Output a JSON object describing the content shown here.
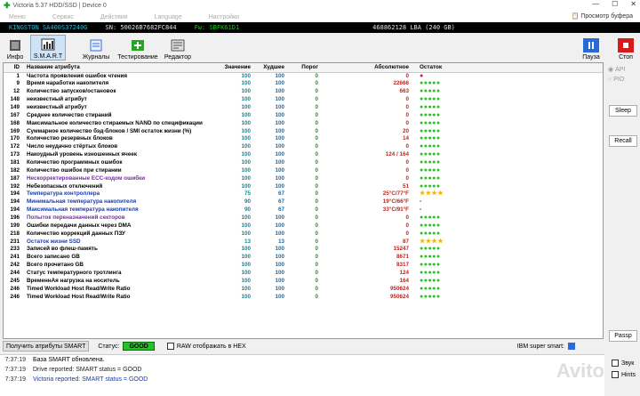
{
  "window": {
    "title": "Victoria 5.37 HDD/SSD | Device 0"
  },
  "menu": {
    "items": [
      "Меню",
      "Сервис",
      "Действия",
      "Language",
      "Настройки"
    ],
    "clipboard_label": "Просмотр буфера"
  },
  "infobar": {
    "model": "KINGSTON SA400S37240G",
    "serial": "SN: 50026B7682FC844",
    "firmware": "Fw: SBFK61D1",
    "lba": "468862128 LBA (240 GB)"
  },
  "toolbar": {
    "info": "Инфо",
    "smart": "S.M.A.R.T",
    "journals": "Журналы",
    "testing": "Тестирование",
    "editor": "Редактор",
    "pause": "Пауза",
    "stop": "Стоп"
  },
  "table": {
    "headers": {
      "id": "ID",
      "name": "Название атрибута",
      "value": "Значение",
      "worst": "Худшее",
      "threshold": "Порог",
      "raw": "Абсолютное",
      "rest": "Остаток"
    },
    "rows": [
      {
        "id": "1",
        "name": "Частота проявления ошибок чтения",
        "value": "100",
        "worst": "100",
        "thr": "0",
        "raw": "0",
        "rest": "●"
      },
      {
        "id": "9",
        "name": "Время наработки накопителя",
        "value": "100",
        "worst": "100",
        "thr": "0",
        "raw": "22666",
        "rest": "●●●●●"
      },
      {
        "id": "12",
        "name": "Количество запусков/остановок",
        "value": "100",
        "worst": "100",
        "thr": "0",
        "raw": "663",
        "rest": "●●●●●"
      },
      {
        "id": "148",
        "name": "неизвестный атрибут",
        "value": "100",
        "worst": "100",
        "thr": "0",
        "raw": "0",
        "rest": "●●●●●"
      },
      {
        "id": "149",
        "name": "неизвестный атрибут",
        "value": "100",
        "worst": "100",
        "thr": "0",
        "raw": "0",
        "rest": "●●●●●"
      },
      {
        "id": "167",
        "name": "Среднее количество стираний",
        "value": "100",
        "worst": "100",
        "thr": "0",
        "raw": "0",
        "rest": "●●●●●"
      },
      {
        "id": "168",
        "name": "Максимальное количество стираемых NAND по спецификации",
        "value": "100",
        "worst": "100",
        "thr": "0",
        "raw": "0",
        "rest": "●●●●●"
      },
      {
        "id": "169",
        "name": "Суммарное количество бэд-блоков / SMI остаток жизни (%)",
        "value": "100",
        "worst": "100",
        "thr": "0",
        "raw": "20",
        "rest": "●●●●●"
      },
      {
        "id": "170",
        "name": "Количество резервных блоков",
        "value": "100",
        "worst": "100",
        "thr": "0",
        "raw": "14",
        "rest": "●●●●●"
      },
      {
        "id": "172",
        "name": "Число неудачно стёртых блоков",
        "value": "100",
        "worst": "100",
        "thr": "0",
        "raw": "0",
        "rest": "●●●●●"
      },
      {
        "id": "173",
        "name": "Накоудный уровень изношенных ячеек",
        "value": "100",
        "worst": "100",
        "thr": "0",
        "raw": "124 / 164",
        "rest": "●●●●●"
      },
      {
        "id": "181",
        "name": "Количество программных ошибок",
        "value": "100",
        "worst": "100",
        "thr": "0",
        "raw": "0",
        "rest": "●●●●●"
      },
      {
        "id": "182",
        "name": "Количество ошибок при стирании",
        "value": "100",
        "worst": "100",
        "thr": "0",
        "raw": "0",
        "rest": "●●●●●"
      },
      {
        "id": "187",
        "name": "Нескорректированные ECC-кодом ошибки",
        "value": "100",
        "worst": "100",
        "thr": "0",
        "raw": "0",
        "rest": "●●●●●",
        "color": "purple"
      },
      {
        "id": "192",
        "name": "Небезопасных отключений",
        "value": "100",
        "worst": "100",
        "thr": "0",
        "raw": "51",
        "rest": "●●●●●"
      },
      {
        "id": "194",
        "name": "Температура контроллера",
        "value": "75",
        "worst": "67",
        "thr": "0",
        "raw": "25°C/77°F",
        "rest": "★★★★",
        "color": "blue"
      },
      {
        "id": "194",
        "name": "Минимальная температура накопителя",
        "value": "90",
        "worst": "67",
        "thr": "0",
        "raw": "19°C/66°F",
        "rest": "-",
        "color": "blue"
      },
      {
        "id": "194",
        "name": "Максимальная температура накопителя",
        "value": "90",
        "worst": "67",
        "thr": "0",
        "raw": "33°C/91°F",
        "rest": "-",
        "color": "blue"
      },
      {
        "id": "196",
        "name": "Попыток переназначений секторов",
        "value": "100",
        "worst": "100",
        "thr": "0",
        "raw": "0",
        "rest": "●●●●●",
        "color": "purple"
      },
      {
        "id": "199",
        "name": "Ошибки передачи данных через DMA",
        "value": "100",
        "worst": "100",
        "thr": "0",
        "raw": "0",
        "rest": "●●●●●"
      },
      {
        "id": "218",
        "name": "Количество коррекций данных ПЗУ",
        "value": "100",
        "worst": "100",
        "thr": "0",
        "raw": "0",
        "rest": "●●●●●"
      },
      {
        "id": "231",
        "name": "Остаток жизни SSD",
        "value": "13",
        "worst": "13",
        "thr": "0",
        "raw": "87",
        "rest": "★★★★",
        "color": "blue"
      },
      {
        "id": "233",
        "name": "Записей во флеш-память",
        "value": "100",
        "worst": "100",
        "thr": "0",
        "raw": "15247",
        "rest": "●●●●●"
      },
      {
        "id": "241",
        "name": "Всего записано GB",
        "value": "100",
        "worst": "100",
        "thr": "0",
        "raw": "8671",
        "rest": "●●●●●"
      },
      {
        "id": "242",
        "name": "Всего прочитано GB",
        "value": "100",
        "worst": "100",
        "thr": "0",
        "raw": "8317",
        "rest": "●●●●●"
      },
      {
        "id": "244",
        "name": "Статус температурного тротлинга",
        "value": "100",
        "worst": "100",
        "thr": "0",
        "raw": "124",
        "rest": "●●●●●"
      },
      {
        "id": "245",
        "name": "ВременнАя нагрузка на носитель",
        "value": "100",
        "worst": "100",
        "thr": "0",
        "raw": "164",
        "rest": "●●●●●"
      },
      {
        "id": "246",
        "name": "Timed Workload Host Read/Write Ratio",
        "value": "100",
        "worst": "100",
        "thr": "0",
        "raw": "950624",
        "rest": "●●●●●"
      },
      {
        "id": "246",
        "name": "Timed Workload Host Read/Write Ratio",
        "value": "100",
        "worst": "100",
        "thr": "0",
        "raw": "950624",
        "rest": "●●●●●"
      }
    ]
  },
  "rail": {
    "api": "API",
    "pio": "PIO",
    "sleep": "Sleep",
    "recall": "Recall",
    "passp": "Passp"
  },
  "statusbar": {
    "get_btn": "Получить атрибуты SMART",
    "status_label": "Статус:",
    "status_value": "GOOD",
    "raw_hex": "RAW отображать в HEX",
    "ibm": "IBM super smart:"
  },
  "log": [
    {
      "time": "7:37:19",
      "text": "База SMART обновлена.",
      "color": "#000000"
    },
    {
      "time": "7:37:19",
      "text": "Drive reported: SMART status = GOOD",
      "color": "#222222"
    },
    {
      "time": "7:37:19",
      "text": "Victoria reported: SMART status = GOOD",
      "color": "#1a3aa8"
    }
  ],
  "side_checks": {
    "sound": "Звук",
    "hints": "Hints"
  },
  "watermark": "Avito",
  "colors": {
    "green_dot": "#22c322",
    "red_dot": "#d81a1a",
    "star": "#f0b400",
    "good": "#22c322"
  }
}
